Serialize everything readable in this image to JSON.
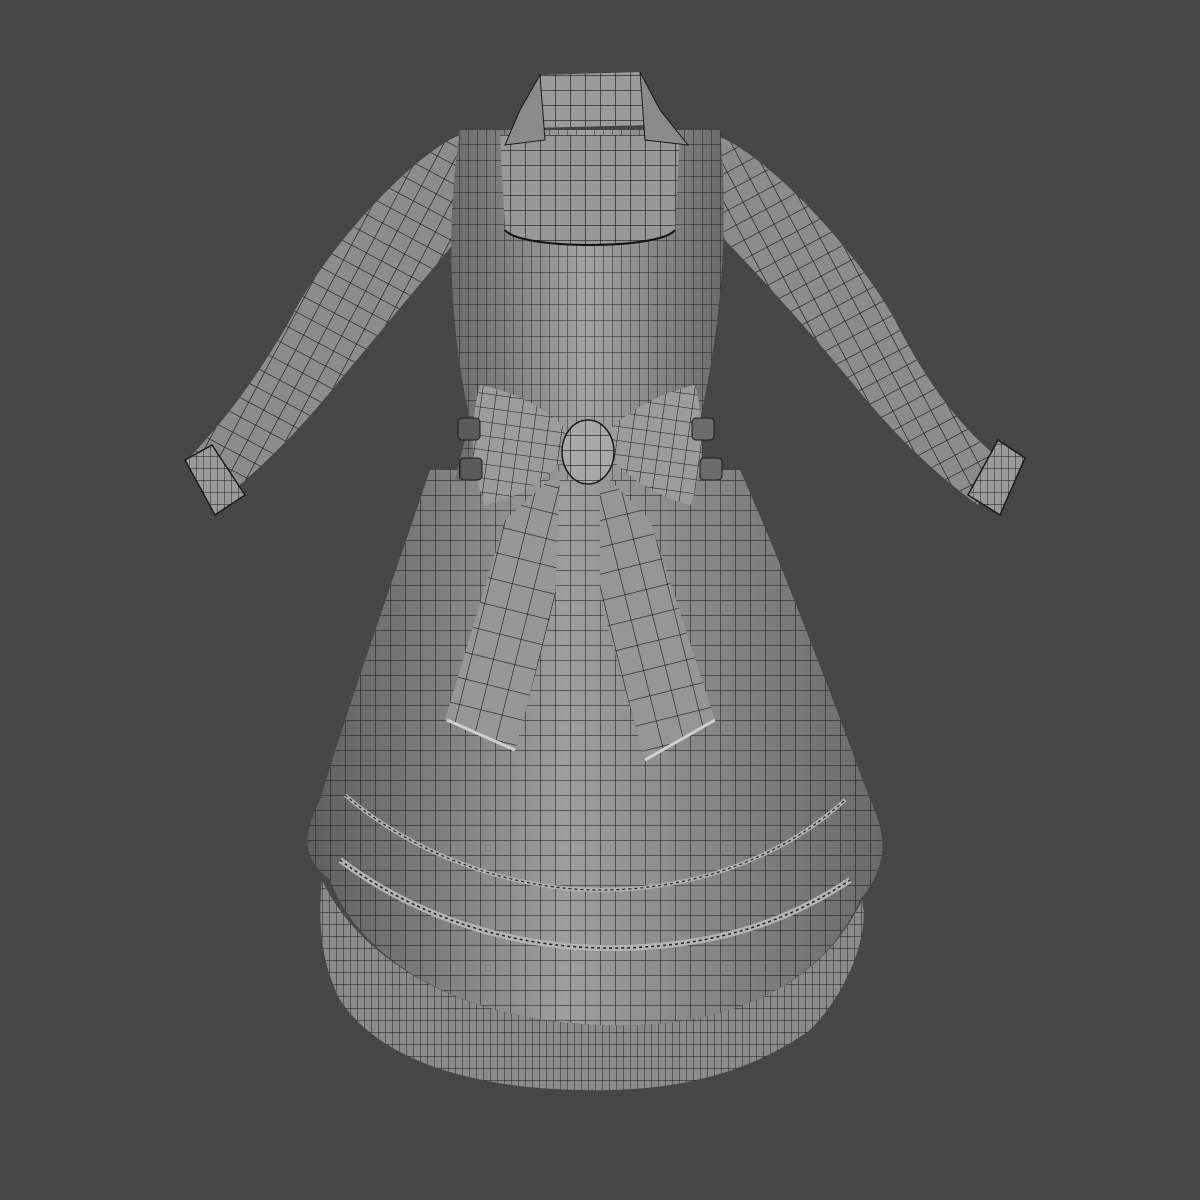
{
  "scene": {
    "background_color": "#464646",
    "subject": "dress-wireframe",
    "view": "back",
    "fabric_color": "#8f8f8f",
    "fabric_highlight": "#a3a3a3",
    "fabric_shadow": "#6a6a6a",
    "wire_color": "#1b1b1b"
  }
}
